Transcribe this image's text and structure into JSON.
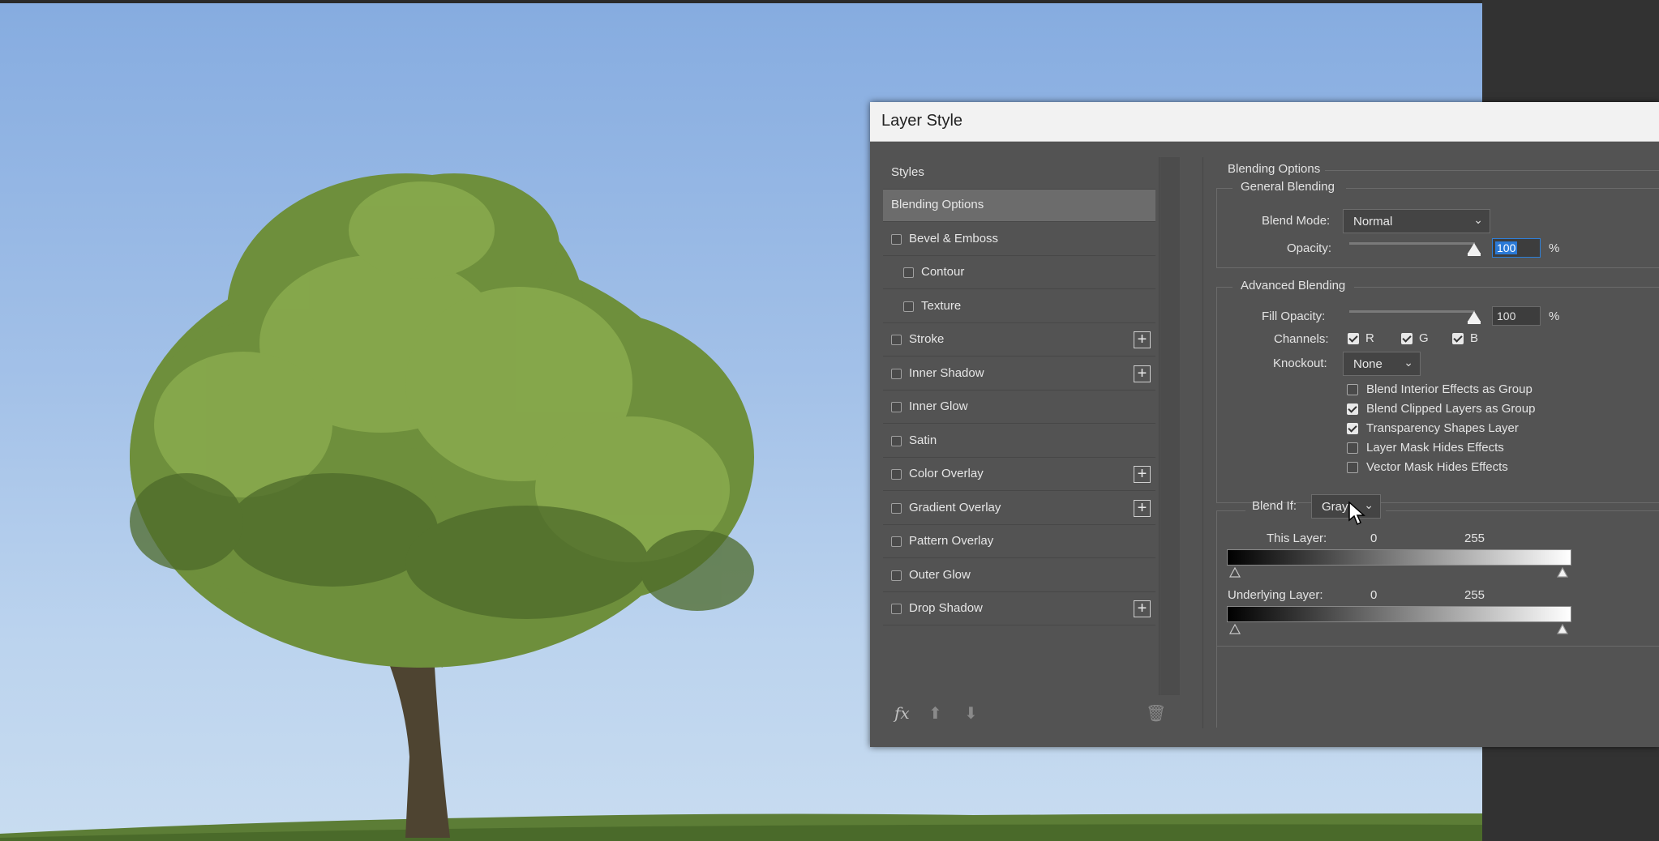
{
  "dialog": {
    "title": "Layer Style"
  },
  "styles_panel": {
    "header": "Styles",
    "items": [
      {
        "label": "Blending Options",
        "checkbox": false,
        "indent": false,
        "plus": false,
        "selected": true
      },
      {
        "label": "Bevel & Emboss",
        "checkbox": true,
        "indent": false,
        "plus": false
      },
      {
        "label": "Contour",
        "checkbox": true,
        "indent": true,
        "plus": false
      },
      {
        "label": "Texture",
        "checkbox": true,
        "indent": true,
        "plus": false
      },
      {
        "label": "Stroke",
        "checkbox": true,
        "indent": false,
        "plus": true
      },
      {
        "label": "Inner Shadow",
        "checkbox": true,
        "indent": false,
        "plus": true
      },
      {
        "label": "Inner Glow",
        "checkbox": true,
        "indent": false,
        "plus": false
      },
      {
        "label": "Satin",
        "checkbox": true,
        "indent": false,
        "plus": false
      },
      {
        "label": "Color Overlay",
        "checkbox": true,
        "indent": false,
        "plus": true
      },
      {
        "label": "Gradient Overlay",
        "checkbox": true,
        "indent": false,
        "plus": true
      },
      {
        "label": "Pattern Overlay",
        "checkbox": true,
        "indent": false,
        "plus": false
      },
      {
        "label": "Outer Glow",
        "checkbox": true,
        "indent": false,
        "plus": false
      },
      {
        "label": "Drop Shadow",
        "checkbox": true,
        "indent": false,
        "plus": true
      }
    ],
    "footer_icons": [
      "fx-icon",
      "move-up-icon",
      "move-down-icon",
      "trash-icon"
    ],
    "fx_label": "fx"
  },
  "blending": {
    "section_title": "Blending Options",
    "general_title": "General Blending",
    "blend_mode_label": "Blend Mode:",
    "blend_mode_value": "Normal",
    "opacity_label": "Opacity:",
    "opacity_value": "100",
    "percent": "%",
    "advanced_title": "Advanced Blending",
    "fill_opacity_label": "Fill Opacity:",
    "fill_opacity_value": "100",
    "channels_label": "Channels:",
    "channels": [
      {
        "label": "R",
        "checked": true
      },
      {
        "label": "G",
        "checked": true
      },
      {
        "label": "B",
        "checked": true
      }
    ],
    "knockout_label": "Knockout:",
    "knockout_value": "None",
    "options": [
      {
        "label": "Blend Interior Effects as Group",
        "checked": false
      },
      {
        "label": "Blend Clipped Layers as Group",
        "checked": true
      },
      {
        "label": "Transparency Shapes Layer",
        "checked": true
      },
      {
        "label": "Layer Mask Hides Effects",
        "checked": false
      },
      {
        "label": "Vector Mask Hides Effects",
        "checked": false
      }
    ],
    "blend_if_label": "Blend If:",
    "blend_if_value": "Gray",
    "this_layer_label": "This Layer:",
    "this_layer_min": "0",
    "this_layer_max": "255",
    "underlying_label": "Underlying Layer:",
    "underlying_min": "0",
    "underlying_max": "255"
  },
  "colors": {
    "dialog_bg": "#535353",
    "selected_row": "#6c6c6c",
    "focus_blue": "#2a79d6"
  }
}
